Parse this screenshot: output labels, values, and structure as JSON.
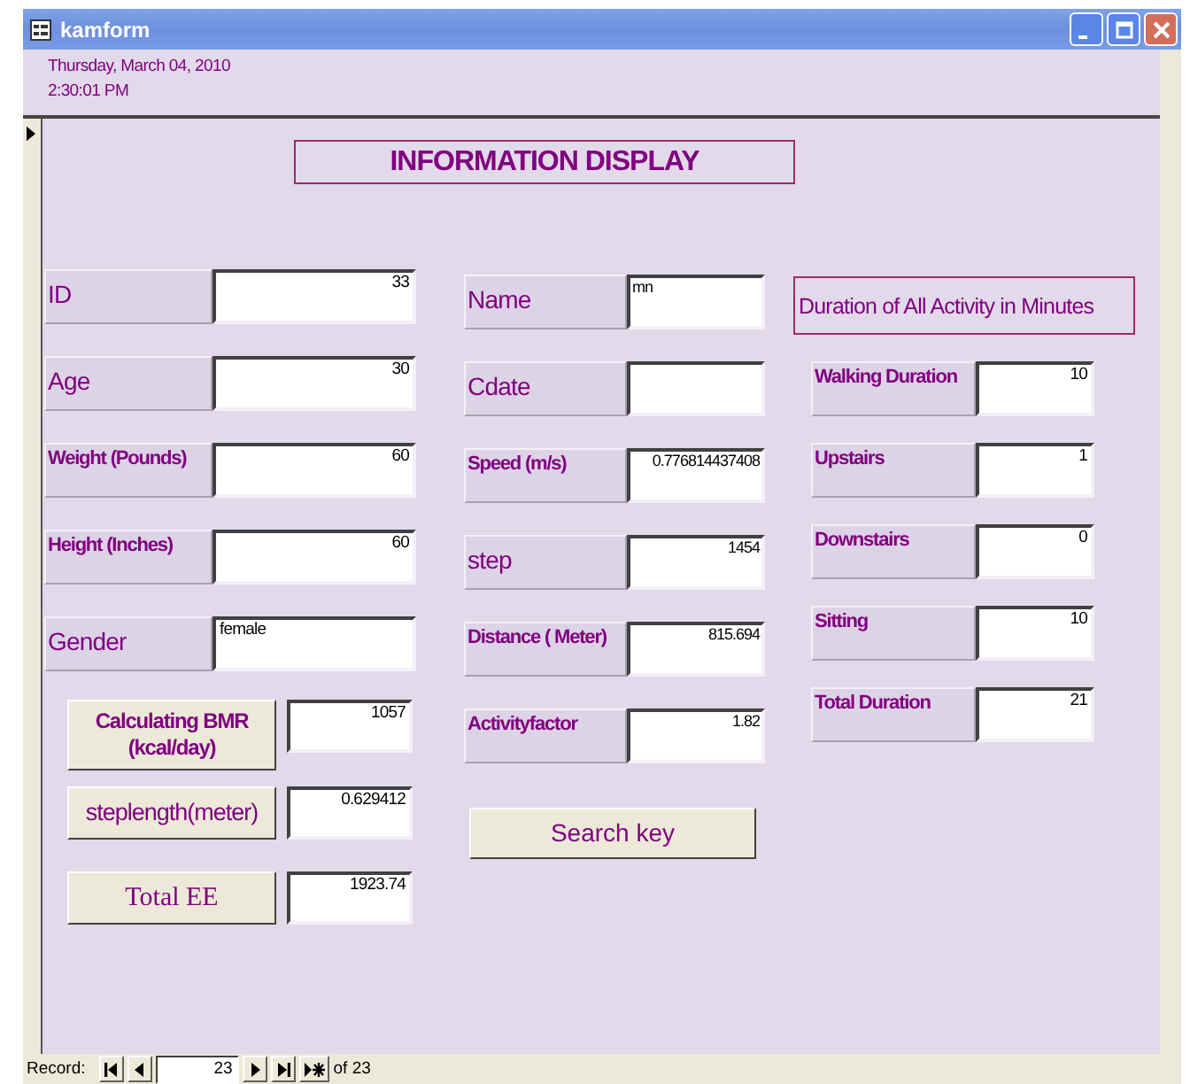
{
  "window": {
    "title": "kamform"
  },
  "header": {
    "date": "Thursday, March 04, 2010",
    "time": "2:30:01 PM"
  },
  "heading": "INFORMATION DISPLAY",
  "left": [
    {
      "kind": "field",
      "label": "ID",
      "value": "33"
    },
    {
      "kind": "field",
      "label": "Age",
      "value": "30"
    },
    {
      "kind": "field",
      "label": "Weight (Pounds)",
      "value": "60"
    },
    {
      "kind": "field",
      "label": "Height (Inches)",
      "value": "60"
    },
    {
      "kind": "field",
      "label": "Gender",
      "value": "female"
    },
    {
      "kind": "button",
      "label": "Calculating BMR (kcal/day)",
      "value": "1057"
    },
    {
      "kind": "button",
      "label": "steplength(meter)",
      "value": "0.629412"
    },
    {
      "kind": "button",
      "label": "Total EE",
      "value": "1923.74"
    }
  ],
  "middle": [
    {
      "kind": "field",
      "label": "Name",
      "value": "mn"
    },
    {
      "kind": "field",
      "label": "Cdate"
    },
    {
      "kind": "field",
      "label": "Speed (m/s)",
      "value": "0.776814437408"
    },
    {
      "kind": "field",
      "label": "step",
      "value": "1454"
    },
    {
      "kind": "field",
      "label": "Distance ( Meter)",
      "value": "815.694"
    },
    {
      "kind": "field",
      "label": "Activityfactor",
      "value": "1.82"
    },
    {
      "kind": "wide-button",
      "label": "Search key"
    }
  ],
  "right": [
    {
      "kind": "caption",
      "label": "Duration of All Activity in Minutes"
    },
    {
      "kind": "field",
      "label": "Walking Duration",
      "value": "10"
    },
    {
      "kind": "field",
      "label": "Upstairs",
      "value": "1"
    },
    {
      "kind": "field",
      "label": "Downstairs",
      "value": "0"
    },
    {
      "kind": "field",
      "label": "Sitting",
      "value": "10"
    },
    {
      "kind": "field",
      "label": "Total Duration",
      "value": "21"
    }
  ],
  "record_nav": {
    "label": "Record:",
    "current": "23",
    "total": "of 23"
  }
}
